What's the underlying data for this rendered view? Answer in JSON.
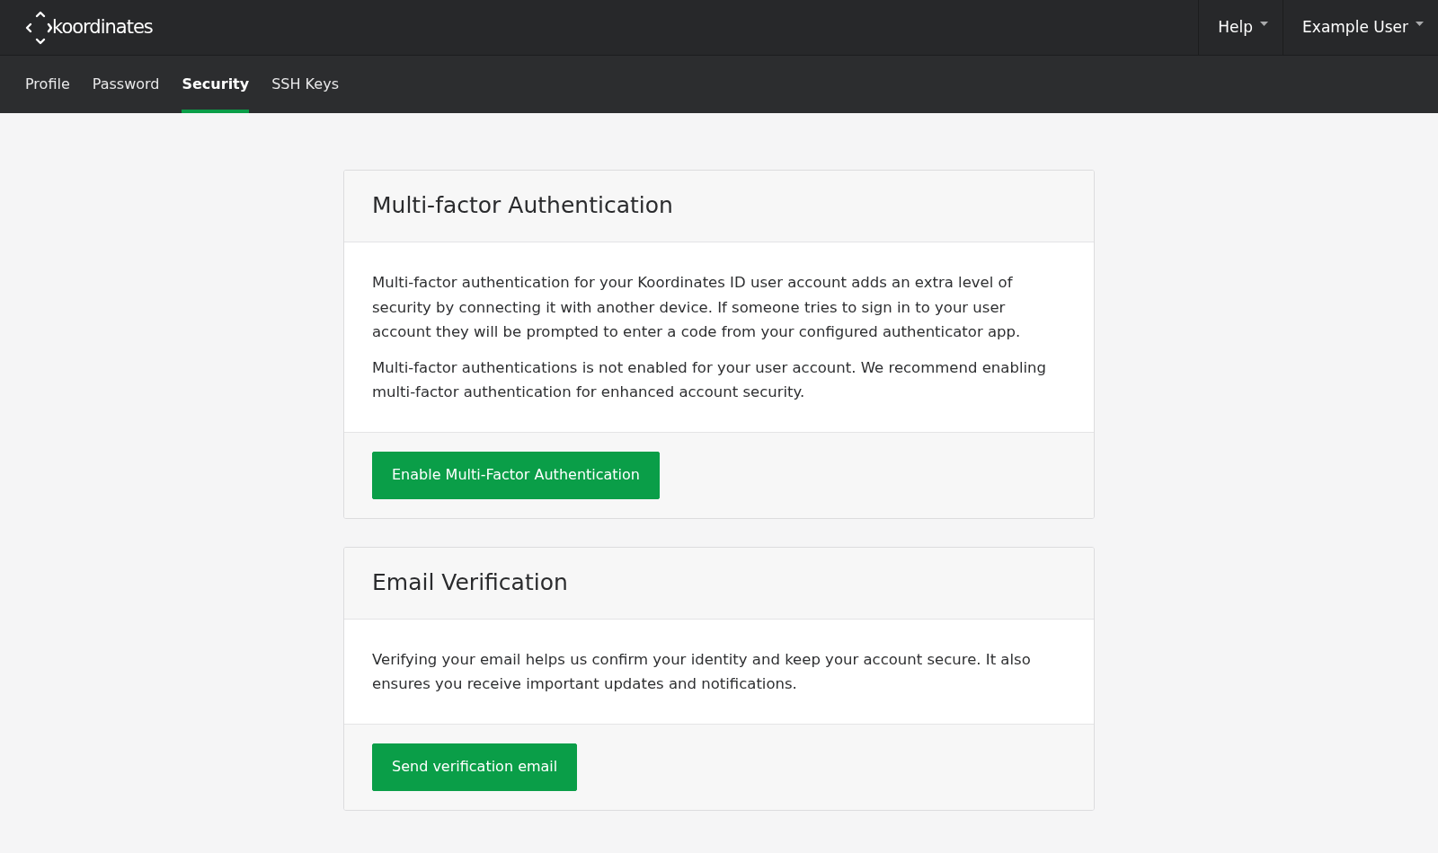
{
  "navbar": {
    "brand": "koordinates",
    "menus": [
      {
        "label": "Help"
      },
      {
        "label": "Example User"
      }
    ]
  },
  "tabs": [
    {
      "label": "Profile",
      "selected": false
    },
    {
      "label": "Password",
      "selected": false
    },
    {
      "label": "Security",
      "selected": true
    },
    {
      "label": "SSH Keys",
      "selected": false
    }
  ],
  "cards": [
    {
      "title": "Multi-factor Authentication",
      "paragraphs": [
        "Multi-factor authentication for your Koordinates ID user account adds an extra level of security by connecting it with another device. If someone tries to sign in to your user account they will be prompted to enter a code from your configured authenticator app.",
        "Multi-factor authentications is not enabled for your user account. We recommend enabling multi-factor authentication for enhanced account security."
      ],
      "button": "Enable Multi-Factor Authentication"
    },
    {
      "title": "Email Verification",
      "paragraphs": [
        "Verifying your email helps us confirm your identity and keep your account secure. It also ensures you receive important updates and notifications."
      ],
      "button": "Send verification email"
    }
  ]
}
